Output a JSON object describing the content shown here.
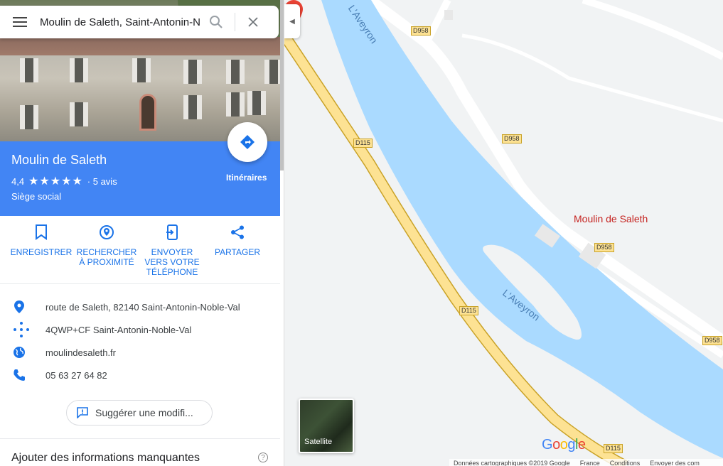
{
  "search": {
    "value": "Moulin de Saleth, Saint-Antonin-N"
  },
  "place": {
    "title": "Moulin de Saleth",
    "rating": "4,4",
    "stars": "★★★★★",
    "review_count": "· 5 avis",
    "category": "Siège social",
    "directions_label": "Itinéraires"
  },
  "actions": [
    {
      "label": "ENREGISTRER",
      "icon": "bookmark-icon"
    },
    {
      "label": "RECHERCHER\nÀ PROXIMITÉ",
      "icon": "nearby-icon"
    },
    {
      "label": "ENVOYER\nVERS VOTRE\nTÉLÉPHONE",
      "icon": "send-to-phone-icon"
    },
    {
      "label": "PARTAGER",
      "icon": "share-icon"
    }
  ],
  "info": {
    "address": "route de Saleth, 82140 Saint-Antonin-Noble-Val",
    "plus_code": "4QWP+CF Saint-Antonin-Noble-Val",
    "website": "moulindesaleth.fr",
    "phone": "05 63 27 64 82"
  },
  "suggest_label": "Suggérer une modifi...",
  "missing_title": "Ajouter des informations manquantes",
  "map": {
    "pin_label": "Moulin de Saleth",
    "road_labels": [
      "D958",
      "D958",
      "D958",
      "D958",
      "D115",
      "D115",
      "D115"
    ],
    "river_labels": [
      "L'Aveyron",
      "L'Aveyron"
    ],
    "satellite_label": "Satellite",
    "logo": "Google",
    "footer": [
      "Données cartographiques ©2019 Google",
      "France",
      "Conditions",
      "Envoyer des com"
    ]
  },
  "colors": {
    "accent": "#4285f4",
    "river": "#aadaff",
    "primary_road": "#fde293",
    "pin": "#ea4335"
  }
}
